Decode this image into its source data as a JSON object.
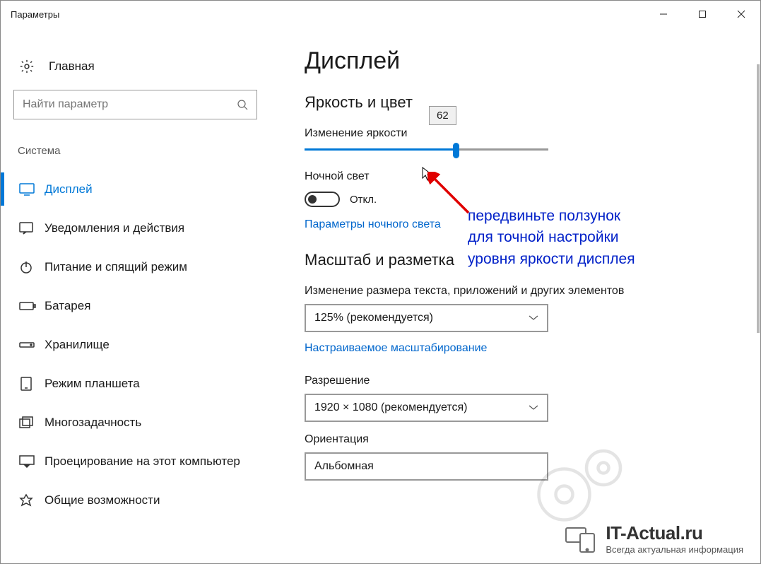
{
  "window": {
    "title": "Параметры"
  },
  "sidebar": {
    "home_label": "Главная",
    "search_placeholder": "Найти параметр",
    "group_label": "Система",
    "items": [
      {
        "label": "Дисплей"
      },
      {
        "label": "Уведомления и действия"
      },
      {
        "label": "Питание и спящий режим"
      },
      {
        "label": "Батарея"
      },
      {
        "label": "Хранилище"
      },
      {
        "label": "Режим планшета"
      },
      {
        "label": "Многозадачность"
      },
      {
        "label": "Проецирование на этот компьютер"
      },
      {
        "label": "Общие возможности"
      }
    ]
  },
  "main": {
    "title": "Дисплей",
    "section1": "Яркость и цвет",
    "brightness_label": "Изменение яркости",
    "brightness_value": "62",
    "nightlight_label": "Ночной свет",
    "toggle_state": "Откл.",
    "nightlight_link": "Параметры ночного света",
    "section2": "Масштаб и разметка",
    "scale_label": "Изменение размера текста, приложений и других элементов",
    "scale_value": "125% (рекомендуется)",
    "custom_scale_link": "Настраиваемое масштабирование",
    "resolution_label": "Разрешение",
    "resolution_value": "1920 × 1080 (рекомендуется)",
    "orientation_label": "Ориентация",
    "orientation_value": "Альбомная"
  },
  "annotation": {
    "line1": "передвиньте ползунок",
    "line2": "для точной настройки",
    "line3": "уровня яркости дисплея"
  },
  "watermark": {
    "site": "IT-Actual.ru",
    "tagline": "Всегда актуальная информация"
  }
}
